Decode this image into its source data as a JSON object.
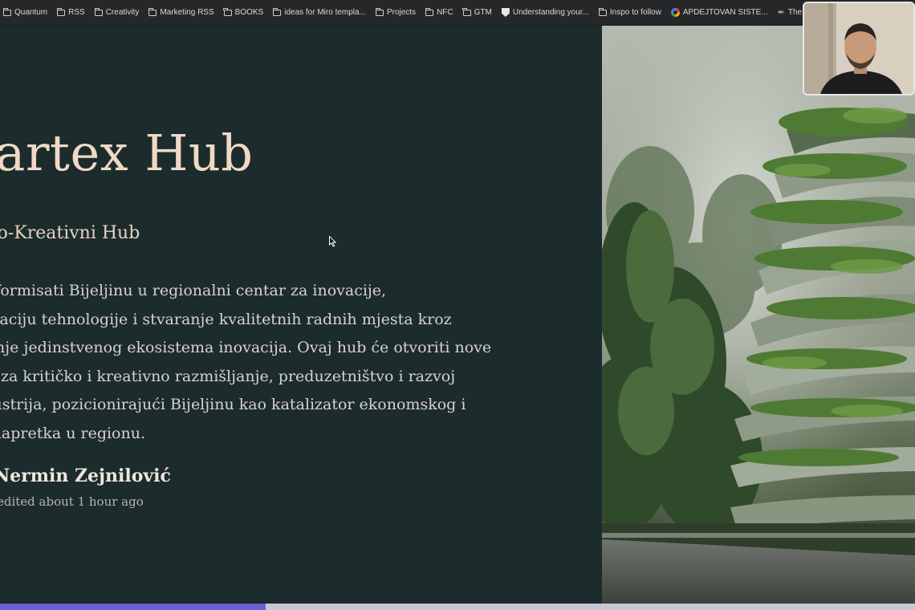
{
  "bookmarks": [
    {
      "label": "Quantum",
      "icon": "folder-icon"
    },
    {
      "label": "RSS",
      "icon": "folder-icon"
    },
    {
      "label": "Creativity",
      "icon": "folder-icon"
    },
    {
      "label": "Marketing RSS",
      "icon": "folder-icon"
    },
    {
      "label": "BOOKS",
      "icon": "folder-icon"
    },
    {
      "label": "ideas for Miro templa...",
      "icon": "folder-icon"
    },
    {
      "label": "Projects",
      "icon": "folder-icon"
    },
    {
      "label": "NFC",
      "icon": "folder-icon"
    },
    {
      "label": "GTM",
      "icon": "folder-icon"
    },
    {
      "label": "Understanding your...",
      "icon": "shield-icon"
    },
    {
      "label": "Inspo to follow",
      "icon": "folder-icon"
    },
    {
      "label": "APDEJTOVAN SISTE...",
      "icon": "google-icon"
    },
    {
      "label": "The",
      "icon": "quill-icon"
    }
  ],
  "slide": {
    "title": "nartex Hub",
    "subtitle": "vno-Kreativni Hub",
    "body_lines": [
      "ansformisati Bijeljinu u regionalni centar za inovacije,",
      "jalizaciju tehnologije i stvaranje kvalitetnih radnih mjesta kroz",
      "vljanje jedinstvenog ekosistema inovacija. Ovaj hub će otvoriti nove",
      "osti za kritičko i kreativno razmišljanje, preduzetništvo i razvoj",
      "industrija, pozicionirajući Bijeljinu kao katalizator ekonomskog i",
      "og napretka u regionu."
    ],
    "author": "Nermin Zejnilović",
    "edited": "edited about 1 hour ago"
  },
  "progress": {
    "fraction": 0.29
  },
  "colors": {
    "slide_bg": "#1c2b2c",
    "title": "#efd9c6",
    "bookmarks_bg": "#262729",
    "progress_fill": "#6b5fd1"
  }
}
